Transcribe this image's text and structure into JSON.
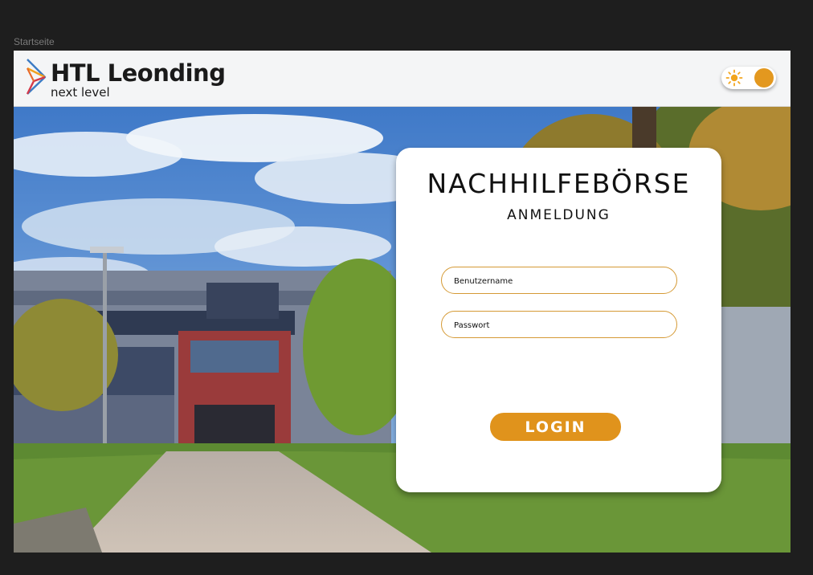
{
  "frame": {
    "label": "Startseite"
  },
  "header": {
    "logo_title": "HTL Leonding",
    "logo_subtitle": "next level",
    "theme_toggle_icon": "sun-icon"
  },
  "login": {
    "title": "NACHHILFEBÖRSE",
    "subtitle": "ANMELDUNG",
    "username_placeholder": "Benutzername",
    "password_placeholder": "Passwort",
    "button_label": "LOGIN"
  },
  "colors": {
    "accent": "#e0931c",
    "field_border": "#d59a35",
    "header_bg": "#f4f5f6",
    "canvas_bg": "#1e1e1e"
  }
}
